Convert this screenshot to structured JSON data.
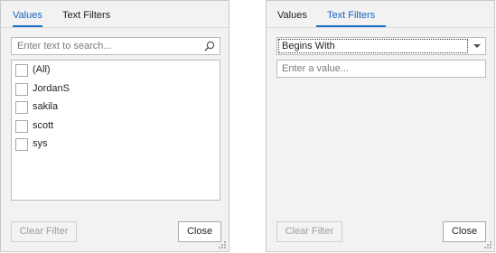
{
  "left_panel": {
    "tabs": [
      {
        "label": "Values",
        "active": true
      },
      {
        "label": "Text Filters",
        "active": false
      }
    ],
    "search": {
      "placeholder": "Enter text to search...",
      "icon": "search-icon"
    },
    "items": [
      {
        "label": "(All)",
        "checked": false
      },
      {
        "label": "JordanS",
        "checked": false
      },
      {
        "label": "sakila",
        "checked": false
      },
      {
        "label": "scott",
        "checked": false
      },
      {
        "label": "sys",
        "checked": false
      }
    ],
    "clear_filter_label": "Clear Filter",
    "close_label": "Close"
  },
  "right_panel": {
    "tabs": [
      {
        "label": "Values",
        "active": false
      },
      {
        "label": "Text Filters",
        "active": true
      }
    ],
    "operator": {
      "selected": "Begins With"
    },
    "value_input": {
      "placeholder": "Enter a value..."
    },
    "clear_filter_label": "Clear Filter",
    "close_label": "Close"
  },
  "colors": {
    "accent": "#1a73c8",
    "panel_bg": "#f2f2f2",
    "border": "#c9c9c9"
  }
}
